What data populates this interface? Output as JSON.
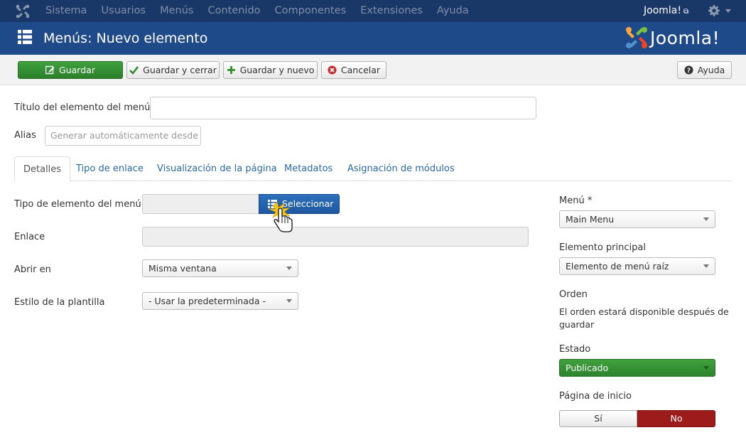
{
  "topnav": {
    "menu": [
      "Sistema",
      "Usuarios",
      "Menús",
      "Contenido",
      "Componentes",
      "Extensiones",
      "Ayuda"
    ],
    "site_link": "Joomla!",
    "site_link_icon": "external-link-icon",
    "settings_icon": "gear-icon"
  },
  "header": {
    "title": "Menús: Nuevo elemento",
    "brand": "Joomla!"
  },
  "toolbar": {
    "save": "Guardar",
    "save_close": "Guardar y cerrar",
    "save_new": "Guardar y nuevo",
    "cancel": "Cancelar",
    "help": "Ayuda"
  },
  "form": {
    "title_label": "Título del elemento del menú *",
    "title_value": "",
    "alias_label": "Alias",
    "alias_placeholder": "Generar automáticamente desde el título"
  },
  "tabs": [
    "Detalles",
    "Tipo de enlace",
    "Visualización de la página",
    "Metadatos",
    "Asignación de módulos"
  ],
  "details": {
    "type_label": "Tipo de elemento del menú *",
    "type_value": "",
    "select_button": "Seleccionar",
    "link_label": "Enlace",
    "link_value": "",
    "open_label": "Abrir en",
    "open_value": "Misma ventana",
    "template_label": "Estilo de la plantilla",
    "template_value": "- Usar la predeterminada -"
  },
  "sidebar": {
    "menu_label": "Menú *",
    "menu_value": "Main Menu",
    "parent_label": "Elemento principal",
    "parent_value": "Elemento de menú raíz",
    "order_label": "Orden",
    "order_note": "El orden estará disponible después de guardar",
    "status_label": "Estado",
    "status_value": "Publicado",
    "home_label": "Página de inicio",
    "home_yes": "Sí",
    "home_no": "No"
  },
  "colors": {
    "topnav_bg": "#1a3867",
    "header_bg": "#1f4a8a",
    "save_green": "#2f8f2e",
    "select_blue": "#1d5aa3",
    "no_red": "#9e1b1b",
    "link_blue": "#2a69a8"
  }
}
